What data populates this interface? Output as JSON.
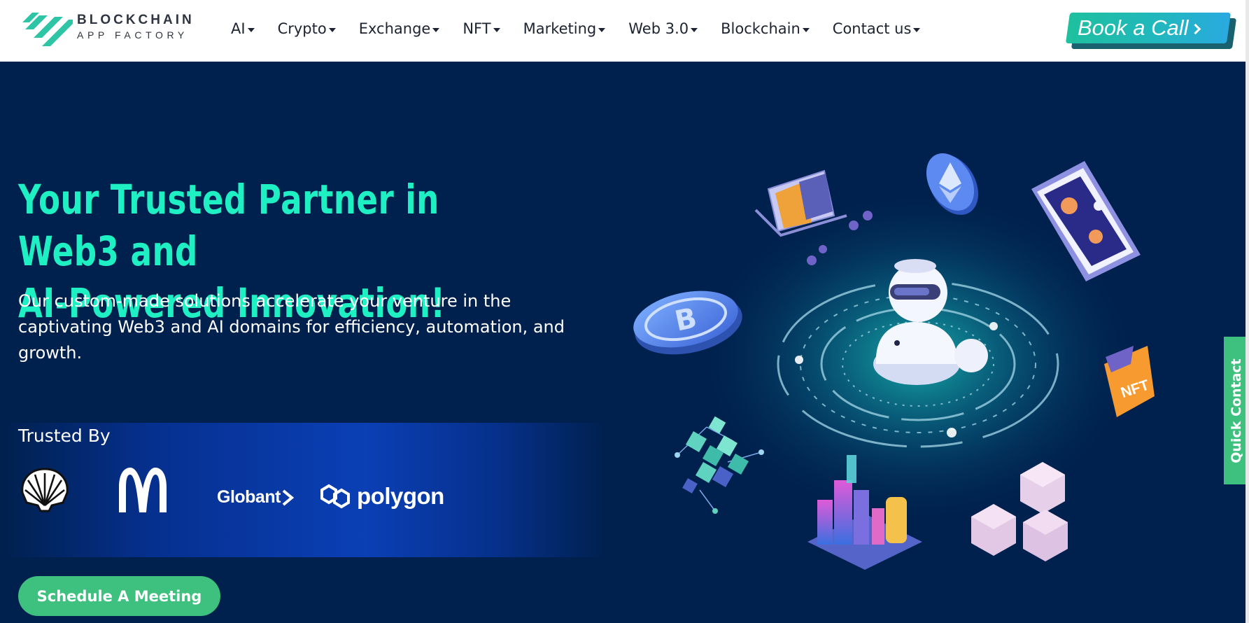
{
  "brand": {
    "logo_line1": "BLOCKCHAIN",
    "logo_line2": "APP FACTORY",
    "accent": "#1ff0c4",
    "green": "#3ec07e",
    "navy": "#00204d"
  },
  "nav": {
    "items": [
      {
        "label": "AI",
        "icon": "caret-down-icon"
      },
      {
        "label": "Crypto",
        "icon": "caret-down-icon"
      },
      {
        "label": "Exchange",
        "icon": "caret-down-icon"
      },
      {
        "label": "NFT",
        "icon": "caret-down-icon"
      },
      {
        "label": "Marketing",
        "icon": "caret-down-icon"
      },
      {
        "label": "Web 3.0",
        "icon": "caret-down-icon"
      },
      {
        "label": "Blockchain",
        "icon": "caret-down-icon"
      },
      {
        "label": "Contact us",
        "icon": "caret-down-icon"
      }
    ],
    "cta_label": "Book a Call",
    "cta_icon": "chevron-right-icon"
  },
  "hero": {
    "title_line1": "Your Trusted Partner in Web3 and",
    "title_line2": "AI-Powered Innovation!",
    "subtitle": "Our custom-made solutions accelerate your venture in the captivating Web3 and AI domains for efficiency, automation, and growth.",
    "schedule_label": "Schedule A Meeting"
  },
  "trusted": {
    "label": "Trusted By",
    "brands": [
      {
        "name": "shell-logo"
      },
      {
        "name": "mcdonalds-logo"
      },
      {
        "name": "Globant"
      },
      {
        "name": "polygon"
      }
    ],
    "globant_text": "Globant",
    "polygon_text": "polygon"
  },
  "illustration": {
    "nft_tag": "NFT",
    "coin_symbol": "B"
  },
  "quick_contact": {
    "label": "Quick Contact"
  }
}
